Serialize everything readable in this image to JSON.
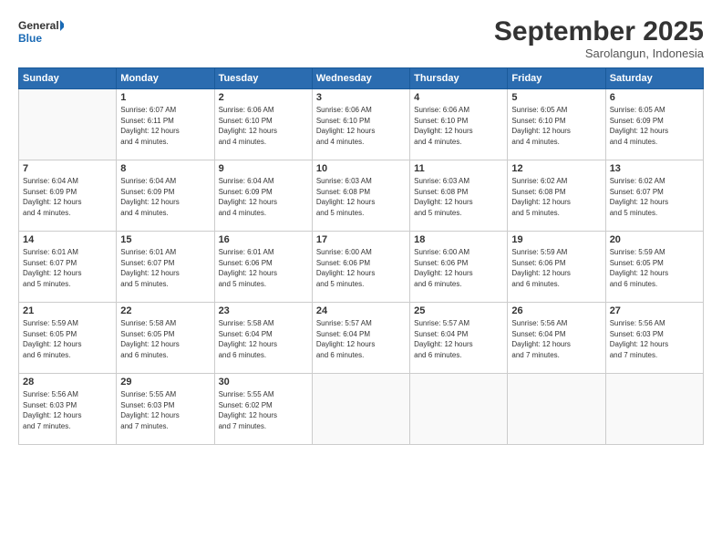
{
  "logo": {
    "line1": "General",
    "line2": "Blue"
  },
  "title": "September 2025",
  "subtitle": "Sarolangun, Indonesia",
  "days_header": [
    "Sunday",
    "Monday",
    "Tuesday",
    "Wednesday",
    "Thursday",
    "Friday",
    "Saturday"
  ],
  "weeks": [
    [
      {
        "day": "",
        "info": ""
      },
      {
        "day": "1",
        "info": "Sunrise: 6:07 AM\nSunset: 6:11 PM\nDaylight: 12 hours\nand 4 minutes."
      },
      {
        "day": "2",
        "info": "Sunrise: 6:06 AM\nSunset: 6:10 PM\nDaylight: 12 hours\nand 4 minutes."
      },
      {
        "day": "3",
        "info": "Sunrise: 6:06 AM\nSunset: 6:10 PM\nDaylight: 12 hours\nand 4 minutes."
      },
      {
        "day": "4",
        "info": "Sunrise: 6:06 AM\nSunset: 6:10 PM\nDaylight: 12 hours\nand 4 minutes."
      },
      {
        "day": "5",
        "info": "Sunrise: 6:05 AM\nSunset: 6:10 PM\nDaylight: 12 hours\nand 4 minutes."
      },
      {
        "day": "6",
        "info": "Sunrise: 6:05 AM\nSunset: 6:09 PM\nDaylight: 12 hours\nand 4 minutes."
      }
    ],
    [
      {
        "day": "7",
        "info": "Sunrise: 6:04 AM\nSunset: 6:09 PM\nDaylight: 12 hours\nand 4 minutes."
      },
      {
        "day": "8",
        "info": "Sunrise: 6:04 AM\nSunset: 6:09 PM\nDaylight: 12 hours\nand 4 minutes."
      },
      {
        "day": "9",
        "info": "Sunrise: 6:04 AM\nSunset: 6:09 PM\nDaylight: 12 hours\nand 4 minutes."
      },
      {
        "day": "10",
        "info": "Sunrise: 6:03 AM\nSunset: 6:08 PM\nDaylight: 12 hours\nand 5 minutes."
      },
      {
        "day": "11",
        "info": "Sunrise: 6:03 AM\nSunset: 6:08 PM\nDaylight: 12 hours\nand 5 minutes."
      },
      {
        "day": "12",
        "info": "Sunrise: 6:02 AM\nSunset: 6:08 PM\nDaylight: 12 hours\nand 5 minutes."
      },
      {
        "day": "13",
        "info": "Sunrise: 6:02 AM\nSunset: 6:07 PM\nDaylight: 12 hours\nand 5 minutes."
      }
    ],
    [
      {
        "day": "14",
        "info": "Sunrise: 6:01 AM\nSunset: 6:07 PM\nDaylight: 12 hours\nand 5 minutes."
      },
      {
        "day": "15",
        "info": "Sunrise: 6:01 AM\nSunset: 6:07 PM\nDaylight: 12 hours\nand 5 minutes."
      },
      {
        "day": "16",
        "info": "Sunrise: 6:01 AM\nSunset: 6:06 PM\nDaylight: 12 hours\nand 5 minutes."
      },
      {
        "day": "17",
        "info": "Sunrise: 6:00 AM\nSunset: 6:06 PM\nDaylight: 12 hours\nand 5 minutes."
      },
      {
        "day": "18",
        "info": "Sunrise: 6:00 AM\nSunset: 6:06 PM\nDaylight: 12 hours\nand 6 minutes."
      },
      {
        "day": "19",
        "info": "Sunrise: 5:59 AM\nSunset: 6:06 PM\nDaylight: 12 hours\nand 6 minutes."
      },
      {
        "day": "20",
        "info": "Sunrise: 5:59 AM\nSunset: 6:05 PM\nDaylight: 12 hours\nand 6 minutes."
      }
    ],
    [
      {
        "day": "21",
        "info": "Sunrise: 5:59 AM\nSunset: 6:05 PM\nDaylight: 12 hours\nand 6 minutes."
      },
      {
        "day": "22",
        "info": "Sunrise: 5:58 AM\nSunset: 6:05 PM\nDaylight: 12 hours\nand 6 minutes."
      },
      {
        "day": "23",
        "info": "Sunrise: 5:58 AM\nSunset: 6:04 PM\nDaylight: 12 hours\nand 6 minutes."
      },
      {
        "day": "24",
        "info": "Sunrise: 5:57 AM\nSunset: 6:04 PM\nDaylight: 12 hours\nand 6 minutes."
      },
      {
        "day": "25",
        "info": "Sunrise: 5:57 AM\nSunset: 6:04 PM\nDaylight: 12 hours\nand 6 minutes."
      },
      {
        "day": "26",
        "info": "Sunrise: 5:56 AM\nSunset: 6:04 PM\nDaylight: 12 hours\nand 7 minutes."
      },
      {
        "day": "27",
        "info": "Sunrise: 5:56 AM\nSunset: 6:03 PM\nDaylight: 12 hours\nand 7 minutes."
      }
    ],
    [
      {
        "day": "28",
        "info": "Sunrise: 5:56 AM\nSunset: 6:03 PM\nDaylight: 12 hours\nand 7 minutes."
      },
      {
        "day": "29",
        "info": "Sunrise: 5:55 AM\nSunset: 6:03 PM\nDaylight: 12 hours\nand 7 minutes."
      },
      {
        "day": "30",
        "info": "Sunrise: 5:55 AM\nSunset: 6:02 PM\nDaylight: 12 hours\nand 7 minutes."
      },
      {
        "day": "",
        "info": ""
      },
      {
        "day": "",
        "info": ""
      },
      {
        "day": "",
        "info": ""
      },
      {
        "day": "",
        "info": ""
      }
    ]
  ]
}
